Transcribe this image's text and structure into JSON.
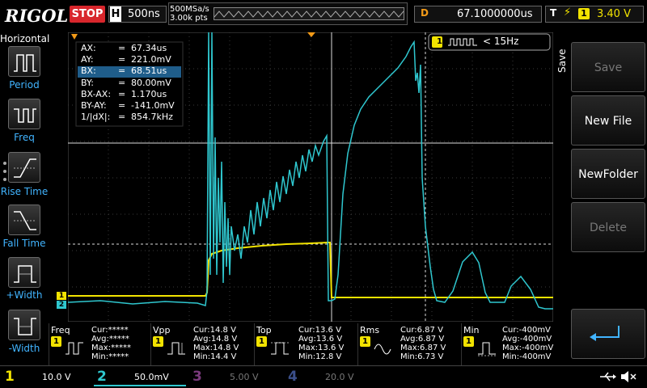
{
  "brand": {
    "name": "RIGOL"
  },
  "run_state": {
    "label": "STOP"
  },
  "timebase": {
    "letter": "H",
    "value": "500ns"
  },
  "sampling": {
    "rate": "500MSa/s",
    "points": "3.00k pts"
  },
  "trigger_delay": {
    "letter": "D",
    "value": "67.1000000us"
  },
  "trigger": {
    "letter": "T",
    "edge_glyph": "⚡",
    "channel": "1",
    "level": "3.40 V"
  },
  "horizontal_menu": {
    "title": "Horizontal",
    "items": [
      {
        "label": "Period",
        "icon": "period-icon"
      },
      {
        "label": "Freq",
        "icon": "freq-icon"
      },
      {
        "label": "Rise Time",
        "icon": "rise-time-icon"
      },
      {
        "label": "Fall Time",
        "icon": "fall-time-icon"
      },
      {
        "label": "+Width",
        "icon": "positive-width-icon"
      },
      {
        "label": "-Width",
        "icon": "negative-width-icon"
      }
    ]
  },
  "cursor_readout": [
    {
      "label": "AX:",
      "value": "67.34us"
    },
    {
      "label": "AY:",
      "value": "221.0mV"
    },
    {
      "label": "BX:",
      "value": "68.51us"
    },
    {
      "label": "BY:",
      "value": "80.00mV"
    },
    {
      "label": "BX-AX:",
      "value": "1.170us"
    },
    {
      "label": "BY-AY:",
      "value": "-141.0mV"
    },
    {
      "label": "1/|dX|:",
      "value": "854.7kHz"
    }
  ],
  "freq_counter": {
    "channel": "1",
    "value": "< 15Hz"
  },
  "save_menu": {
    "title": "Save",
    "buttons": [
      {
        "label": "Save",
        "enabled": false
      },
      {
        "label": "New File",
        "enabled": true
      },
      {
        "label": "NewFolder",
        "enabled": true
      },
      {
        "label": "Delete",
        "enabled": false
      }
    ],
    "back_icon": "return-arrow-icon"
  },
  "measurements": [
    {
      "name": "Freq",
      "channel": "1",
      "cur": "Cur:*****",
      "avg": "Avg:*****",
      "max": "Max:*****",
      "min": "Min:*****"
    },
    {
      "name": "Vpp",
      "channel": "1",
      "cur": "Cur:14.8 V",
      "avg": "Avg:14.8 V",
      "max": "Max:14.8 V",
      "min": "Min:14.4 V"
    },
    {
      "name": "Top",
      "channel": "1",
      "cur": "Cur:13.6 V",
      "avg": "Avg:13.6 V",
      "max": "Max:13.6 V",
      "min": "Min:12.8 V"
    },
    {
      "name": "Rms",
      "channel": "1",
      "cur": "Cur:6.87 V",
      "avg": "Avg:6.87 V",
      "max": "Max:6.87 V",
      "min": "Min:6.73 V"
    },
    {
      "name": "Min",
      "channel": "1",
      "cur": "Cur:-400mV",
      "avg": "Avg:-400mV",
      "max": "Max:-400mV",
      "min": "Min:-400mV"
    }
  ],
  "channels": [
    {
      "num": "1",
      "scale": "10.0 V",
      "color": "#f2e300",
      "active": true
    },
    {
      "num": "2",
      "scale": "50.0mV",
      "color": "#00c9d6",
      "active": true
    },
    {
      "num": "3",
      "scale": "5.00 V",
      "color": "#c33bc4",
      "active": false
    },
    {
      "num": "4",
      "scale": "20.0 V",
      "color": "#3b5fd1",
      "active": false
    }
  ],
  "colors": {
    "ch1": "#f2e300",
    "ch2": "#2fc7cf",
    "trigger": "#f29a18",
    "accent": "#41b4ff",
    "stop": "#d8262c"
  },
  "status_icons": [
    "usb-icon",
    "speaker-icon"
  ]
}
